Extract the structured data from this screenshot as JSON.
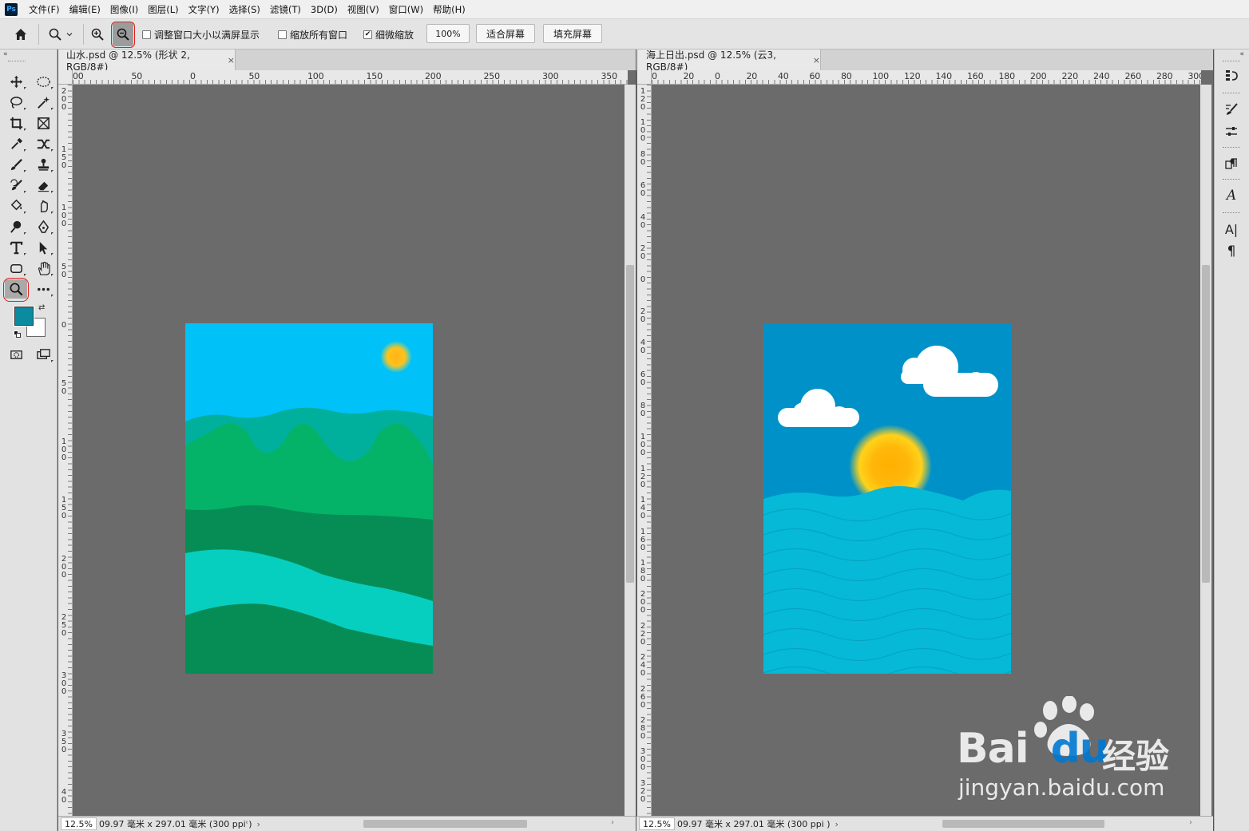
{
  "app": {
    "logo": "Ps"
  },
  "menu": [
    "文件(F)",
    "编辑(E)",
    "图像(I)",
    "图层(L)",
    "文字(Y)",
    "选择(S)",
    "滤镜(T)",
    "3D(D)",
    "视图(V)",
    "窗口(W)",
    "帮助(H)"
  ],
  "options": {
    "resize_windows_label": "调整窗口大小以满屏显示",
    "zoom_all_label": "缩放所有窗口",
    "scrubby_zoom_label": "细微缩放",
    "zoom_value": "100%",
    "fit_screen_label": "适合屏幕",
    "fill_screen_label": "填充屏幕",
    "resize_windows_checked": false,
    "zoom_all_checked": false,
    "scrubby_zoom_checked": true
  },
  "colors": {
    "foreground": "#0a8ba0",
    "background": "#ffffff",
    "annotation": "#e3201b"
  },
  "doc1": {
    "tab_title": "山水.psd @ 12.5% (形状 2, RGB/8#)",
    "close": "×",
    "zoom": "12.5%",
    "doc_info": "09.97 毫米 x 297.01 毫米 (300 ppi )",
    "hruler": [
      "00",
      "50",
      "0",
      "50",
      "100",
      "150",
      "200",
      "250",
      "300",
      "350"
    ],
    "vruler": [
      "200",
      "150",
      "100",
      "50",
      "0",
      "50",
      "100",
      "150",
      "200",
      "250",
      "300",
      "350",
      "40"
    ]
  },
  "doc2": {
    "tab_title": "海上日出.psd @ 12.5% (云3, RGB/8#)",
    "close": "×",
    "zoom": "12.5%",
    "doc_info": "09.97 毫米 x 297.01 毫米 (300 ppi )",
    "hruler": [
      "0",
      "20",
      "0",
      "20",
      "40",
      "60",
      "80",
      "100",
      "120",
      "140",
      "160",
      "180",
      "200",
      "220",
      "240",
      "260",
      "280",
      "300"
    ],
    "vruler": [
      "120",
      "100",
      "80",
      "60",
      "40",
      "20",
      "0",
      "20",
      "40",
      "60",
      "80",
      "100",
      "120",
      "140",
      "160",
      "180",
      "200",
      "220",
      "240",
      "260",
      "280",
      "300",
      "320"
    ]
  },
  "watermark": {
    "brand": "Bai",
    "brand2": "du",
    "cn": "经验",
    "url": "jingyan.baidu.com"
  }
}
